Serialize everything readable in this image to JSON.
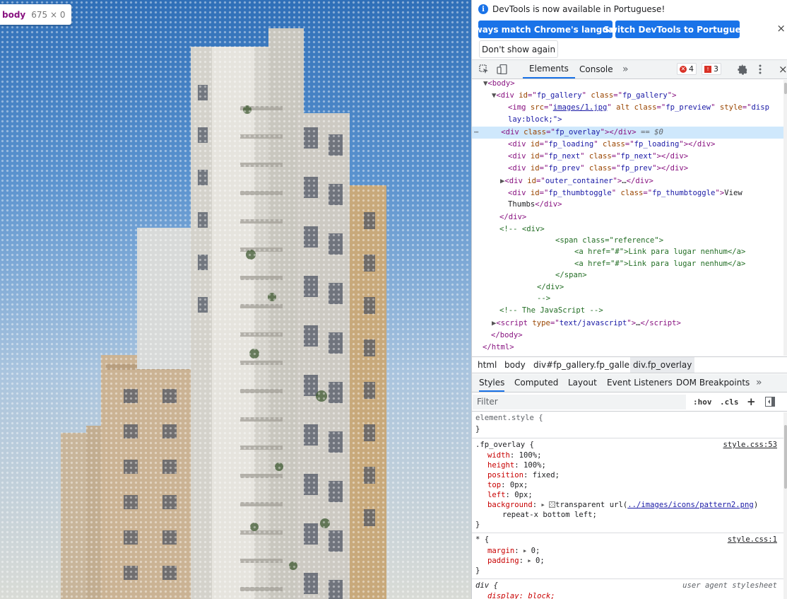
{
  "tooltip": {
    "tag": "body",
    "dimensions": "675 × 0"
  },
  "infobar": {
    "message": "DevTools is now available in Portuguese!",
    "btn_match": "Always match Chrome's language",
    "btn_switch": "Switch DevTools to Portuguese",
    "btn_dont_show": "Don't show again",
    "close": "×"
  },
  "toolbar": {
    "tabs": [
      "Elements",
      "Console"
    ],
    "more": "»",
    "error_count": "4",
    "warning_count": "3"
  },
  "dom": {
    "l1": "<body>",
    "l2_id": "fp_gallery",
    "l2_class": "fp_gallery",
    "l3_src": "images/1.jpg",
    "l3_class": "fp_preview",
    "l3_style": "disp",
    "l3b": "lay:block;\">",
    "l4_class": "fp_overlay",
    "l4_marker": "== $0",
    "l5_id": "fp_loading",
    "l5_class": "fp_loading",
    "l6_id": "fp_next",
    "l6_class": "fp_next",
    "l7_id": "fp_prev",
    "l7_class": "fp_prev",
    "l8_id": "outer_container",
    "l9_id": "fp_thumbtoggle",
    "l9_class": "fp_thumbtoggle",
    "l9_text": "View",
    "l9b": "Thumbs",
    "comment1": "<!-- <div>",
    "comment2": "<span class=\"reference\">",
    "comment3": "<a href=\"#\">Link para lugar nenhum</a>",
    "comment4": "<a href=\"#\">Link para lugar nenhum</a>",
    "comment5": "</span>",
    "comment6": "</div>",
    "comment7": "-->",
    "comment8": "<!-- The JavaScript -->",
    "script_type": "text/javascript",
    "end_body": "</body>",
    "end_html": "</html>"
  },
  "breadcrumbs": [
    "html",
    "body",
    "div#fp_gallery.fp_gallery",
    "div.fp_overlay"
  ],
  "subtabs": [
    "Styles",
    "Computed",
    "Layout",
    "Event Listeners",
    "DOM Breakpoints",
    "»"
  ],
  "filter": {
    "placeholder": "Filter",
    "hov": ":hov",
    "cls": ".cls",
    "plus": "+"
  },
  "styles": {
    "element_style": "element.style {",
    "close_brace": "}",
    "rule1_selector": ".fp_overlay {",
    "rule1_source": "style.css:53",
    "rule1_props": [
      {
        "name": "width",
        "value": "100%;"
      },
      {
        "name": "height",
        "value": "100%;"
      },
      {
        "name": "position",
        "value": "fixed;"
      },
      {
        "name": "top",
        "value": "0px;"
      },
      {
        "name": "left",
        "value": "0px;"
      }
    ],
    "bg_name": "background",
    "bg_value_a": "transparent url(",
    "bg_url": "../images/icons/pattern2.png",
    "bg_value_b": ")",
    "bg_value_c": "repeat-x bottom left;",
    "rule2_selector": "* {",
    "rule2_source": "style.css:1",
    "rule2_props": [
      {
        "name": "margin",
        "value": "0;"
      },
      {
        "name": "padding",
        "value": "0;"
      }
    ],
    "rule3_selector": "div {",
    "rule3_source": "user agent stylesheet",
    "rule3_prop": "display: block;"
  },
  "colors": {
    "accent": "#1a73e8",
    "tag": "#881280",
    "attr_name": "#994500",
    "attr_value": "#1a1aa6",
    "comment": "#236e25",
    "selected_row": "#cfe8fc"
  }
}
